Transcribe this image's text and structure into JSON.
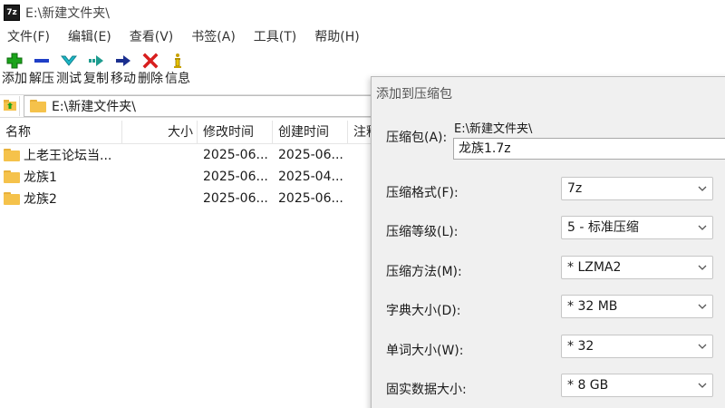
{
  "window": {
    "icon_text": "7z",
    "title": "E:\\新建文件夹\\"
  },
  "menu": [
    "文件(F)",
    "编辑(E)",
    "查看(V)",
    "书签(A)",
    "工具(T)",
    "帮助(H)"
  ],
  "toolbar": [
    {
      "label": "添加",
      "icon": "add-icon",
      "color": "#1aa31a"
    },
    {
      "label": "解压",
      "icon": "extract-icon",
      "color": "#1f3fc7"
    },
    {
      "label": "测试",
      "icon": "test-icon",
      "color": "#1cb7c7"
    },
    {
      "label": "复制",
      "icon": "copy-icon",
      "color": "#1e9c8f"
    },
    {
      "label": "移动",
      "icon": "move-icon",
      "color": "#1b2f8f"
    },
    {
      "label": "删除",
      "icon": "delete-icon",
      "color": "#d81e1e"
    },
    {
      "label": "信息",
      "icon": "info-icon",
      "color": "#c9a200"
    }
  ],
  "address": {
    "path": "E:\\新建文件夹\\"
  },
  "file_list": {
    "columns": [
      "名称",
      "大小",
      "修改时间",
      "创建时间",
      "注释"
    ],
    "rows": [
      {
        "name": "上老王论坛当...",
        "size": "",
        "modified": "2025-06...",
        "created": "2025-06..."
      },
      {
        "name": "龙族1",
        "size": "",
        "modified": "2025-06...",
        "created": "2025-04..."
      },
      {
        "name": "龙族2",
        "size": "",
        "modified": "2025-06...",
        "created": "2025-06..."
      }
    ]
  },
  "dialog": {
    "title": "添加到压缩包",
    "archive_label": "压缩包(A):",
    "archive_path": "E:\\新建文件夹\\",
    "archive_name": "龙族1.7z",
    "fields": [
      {
        "label": "压缩格式(F):",
        "value": "7z"
      },
      {
        "label": "压缩等级(L):",
        "value": "5 - 标准压缩"
      },
      {
        "label": "压缩方法(M):",
        "value": "*  LZMA2"
      },
      {
        "label": "字典大小(D):",
        "value": "*  32 MB"
      },
      {
        "label": "单词大小(W):",
        "value": "*  32"
      },
      {
        "label": "固实数据大小:",
        "value": "*  8 GB"
      }
    ]
  }
}
